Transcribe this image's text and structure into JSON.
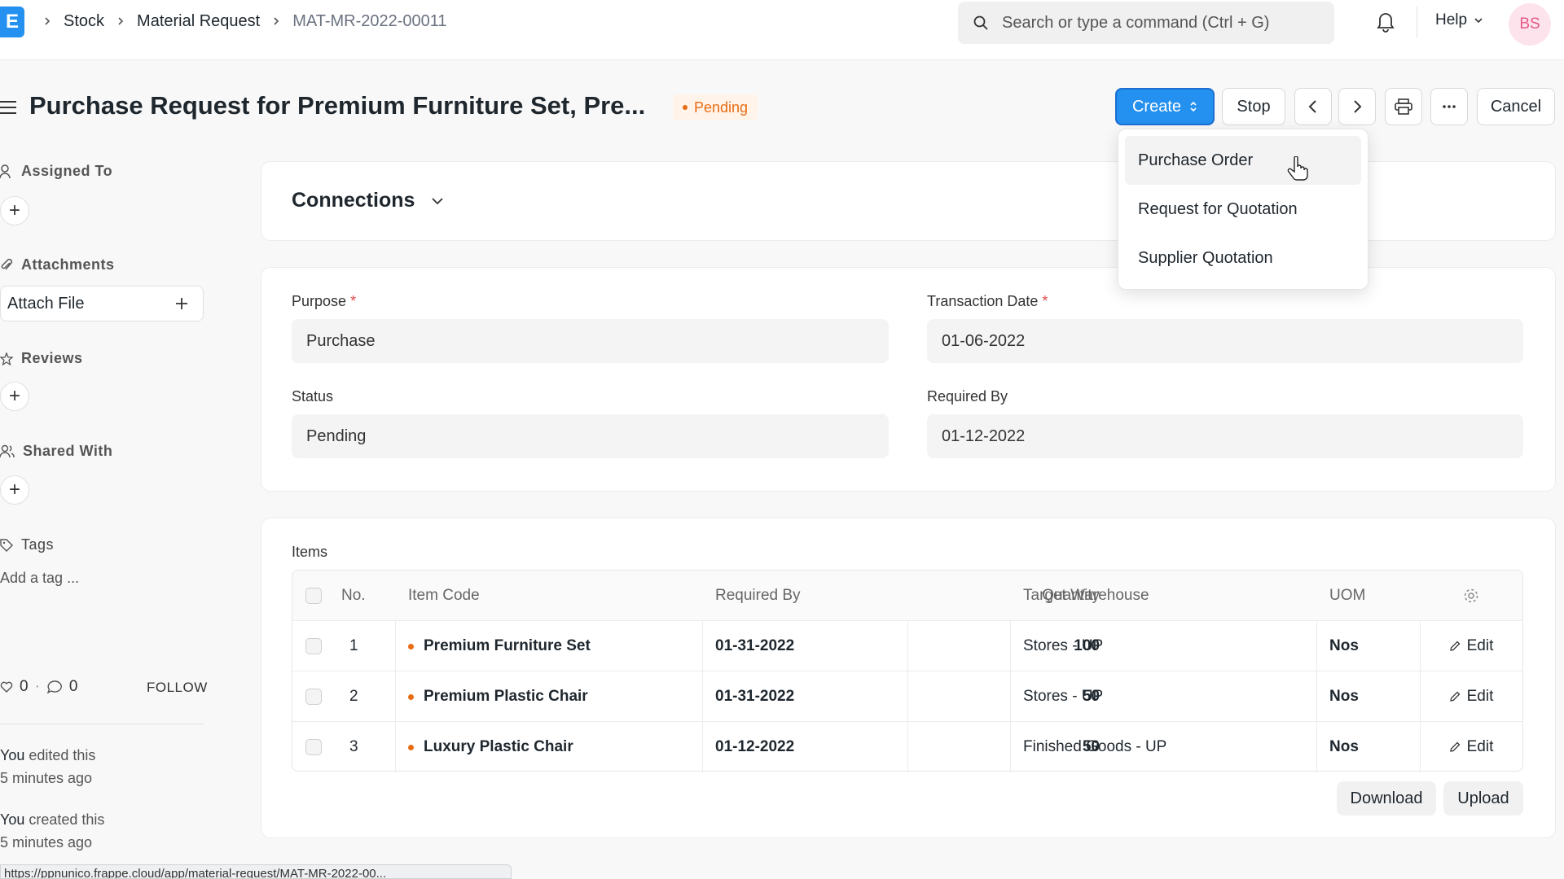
{
  "navbar": {
    "logo_letter": "E",
    "breadcrumbs": [
      "Stock",
      "Material Request",
      "MAT-MR-2022-00011"
    ],
    "search_placeholder": "Search or type a command (Ctrl + G)",
    "help_label": "Help",
    "avatar_initials": "BS"
  },
  "header": {
    "title": "Purchase Request for Premium Furniture Set, Pre...",
    "status": "Pending",
    "create_label": "Create",
    "stop_label": "Stop",
    "cancel_label": "Cancel"
  },
  "create_menu": [
    "Purchase Order",
    "Request for Quotation",
    "Supplier Quotation"
  ],
  "sidebar": {
    "assigned_to": "Assigned To",
    "attachments": "Attachments",
    "attach_file": "Attach File",
    "reviews": "Reviews",
    "shared_with": "Shared With",
    "tags": "Tags",
    "add_tag": "Add a tag ...",
    "likes": "0",
    "comments": "0",
    "follow": "FOLLOW",
    "activity": [
      {
        "who": "You",
        "action": " edited this",
        "when": "5 minutes ago"
      },
      {
        "who": "You",
        "action": " created this",
        "when": "5 minutes ago"
      }
    ]
  },
  "connections": {
    "title": "Connections"
  },
  "form": {
    "purpose_label": "Purpose",
    "purpose_value": "Purchase",
    "transaction_date_label": "Transaction Date",
    "transaction_date_value": "01-06-2022",
    "status_label": "Status",
    "status_value": "Pending",
    "required_by_label": "Required By",
    "required_by_value": "01-12-2022"
  },
  "items": {
    "label": "Items",
    "columns": [
      "No.",
      "Item Code",
      "Required By",
      "Quantity",
      "Target Warehouse",
      "UOM"
    ],
    "rows": [
      {
        "no": "1",
        "item_code": "Premium Furniture Set",
        "required_by": "01-31-2022",
        "qty": "100",
        "warehouse": "Stores - UP",
        "uom": "Nos",
        "edit": "Edit"
      },
      {
        "no": "2",
        "item_code": "Premium Plastic Chair",
        "required_by": "01-31-2022",
        "qty": "50",
        "warehouse": "Stores - UP",
        "uom": "Nos",
        "edit": "Edit"
      },
      {
        "no": "3",
        "item_code": "Luxury Plastic Chair",
        "required_by": "01-12-2022",
        "qty": "50",
        "warehouse": "Finished Goods - UP",
        "uom": "Nos",
        "edit": "Edit"
      }
    ],
    "download_label": "Download",
    "upload_label": "Upload"
  },
  "statusbar_url": "https://ppnunico.frappe.cloud/app/material-request/MAT-MR-2022-00..."
}
